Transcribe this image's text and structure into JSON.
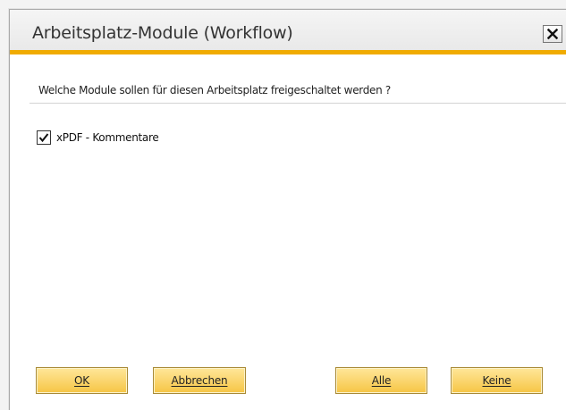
{
  "dialog": {
    "title": "Arbeitsplatz-Module (Workflow)",
    "question": "Welche Module sollen für diesen Arbeitsplatz freigeschaltet werden ?",
    "accent_color": "#f0ab00",
    "close_icon": "close-icon"
  },
  "modules": [
    {
      "label": "xPDF - Kommentare",
      "checked": true
    }
  ],
  "buttons": {
    "ok": "OK",
    "cancel": "Abbrechen",
    "all": "Alle",
    "none": "Keine"
  }
}
